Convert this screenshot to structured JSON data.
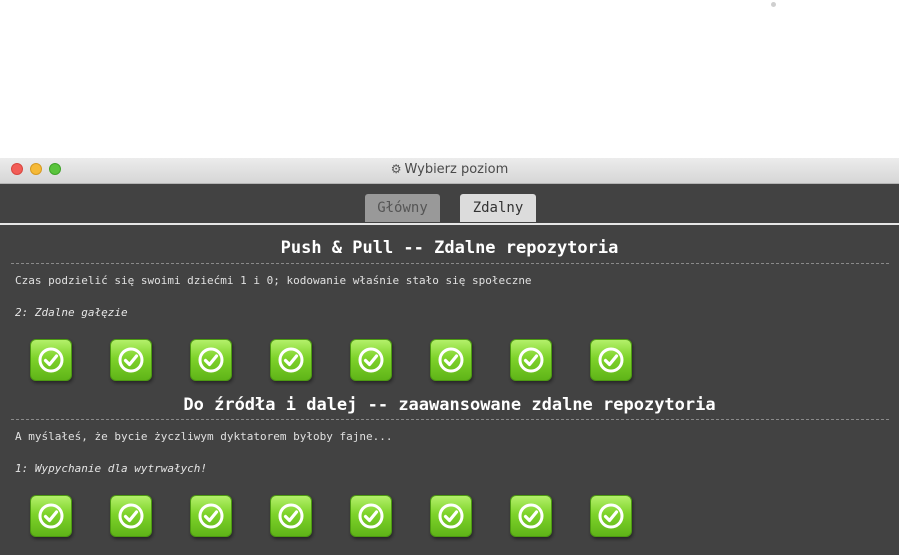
{
  "window": {
    "title": "Wybierz poziom",
    "title_icon": "gear-icon"
  },
  "tabs": [
    {
      "label": "Główny",
      "active": false
    },
    {
      "label": "Zdalny",
      "active": true
    }
  ],
  "sections": [
    {
      "title": "Push & Pull -- Zdalne repozytoria",
      "description": "Czas podzielić się swoimi dziećmi 1 i 0; kodowanie właśnie stało się społeczne",
      "subtitle": "2: Zdalne gałęzie",
      "level_count": 8,
      "level_status": "completed"
    },
    {
      "title": "Do źródła i dalej -- zaawansowane zdalne repozytoria",
      "description": "A myślałeś, że bycie życzliwym dyktatorem byłoby fajne...",
      "subtitle": "1: Wypychanie dla wytrwałych!",
      "level_count": 8,
      "level_status": "completed"
    }
  ],
  "colors": {
    "window_bg": "#424242",
    "level_green": "#7ed32a",
    "check_white": "#ffffff"
  }
}
